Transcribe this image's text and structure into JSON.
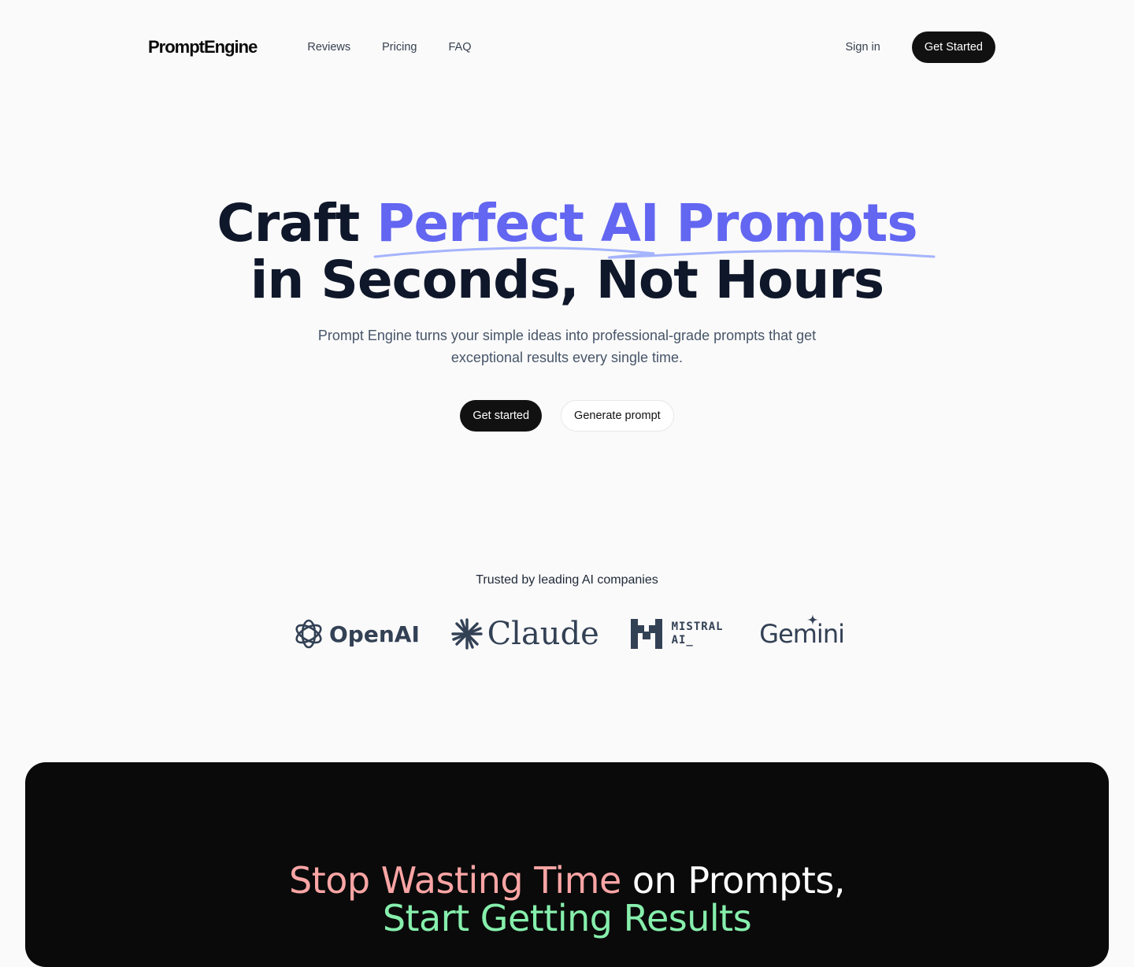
{
  "nav": {
    "logo": "PromptEngine",
    "links": [
      "Reviews",
      "Pricing",
      "FAQ"
    ],
    "signin": "Sign in",
    "cta": "Get Started"
  },
  "hero": {
    "title_prefix": "Craft ",
    "title_accent": "Perfect AI Prompts",
    "title_line2": "in Seconds, Not Hours",
    "subtitle": "Prompt Engine turns your simple ideas into professional-grade prompts that get exceptional results every single time.",
    "primary_button": "Get started",
    "secondary_button": "Generate prompt"
  },
  "trusted": {
    "label": "Trusted by leading AI companies",
    "brands": [
      "OpenAI",
      "Claude",
      "MISTRAL AI_",
      "Gemini"
    ]
  },
  "results": {
    "title_pink": "Stop Wasting Time",
    "title_mid": " on Prompts,",
    "title_green": "Start Getting Results"
  },
  "colors": {
    "accent": "#6366f1",
    "pink": "#fca5a5",
    "green": "#86efac",
    "dark": "#0a0a0a"
  }
}
